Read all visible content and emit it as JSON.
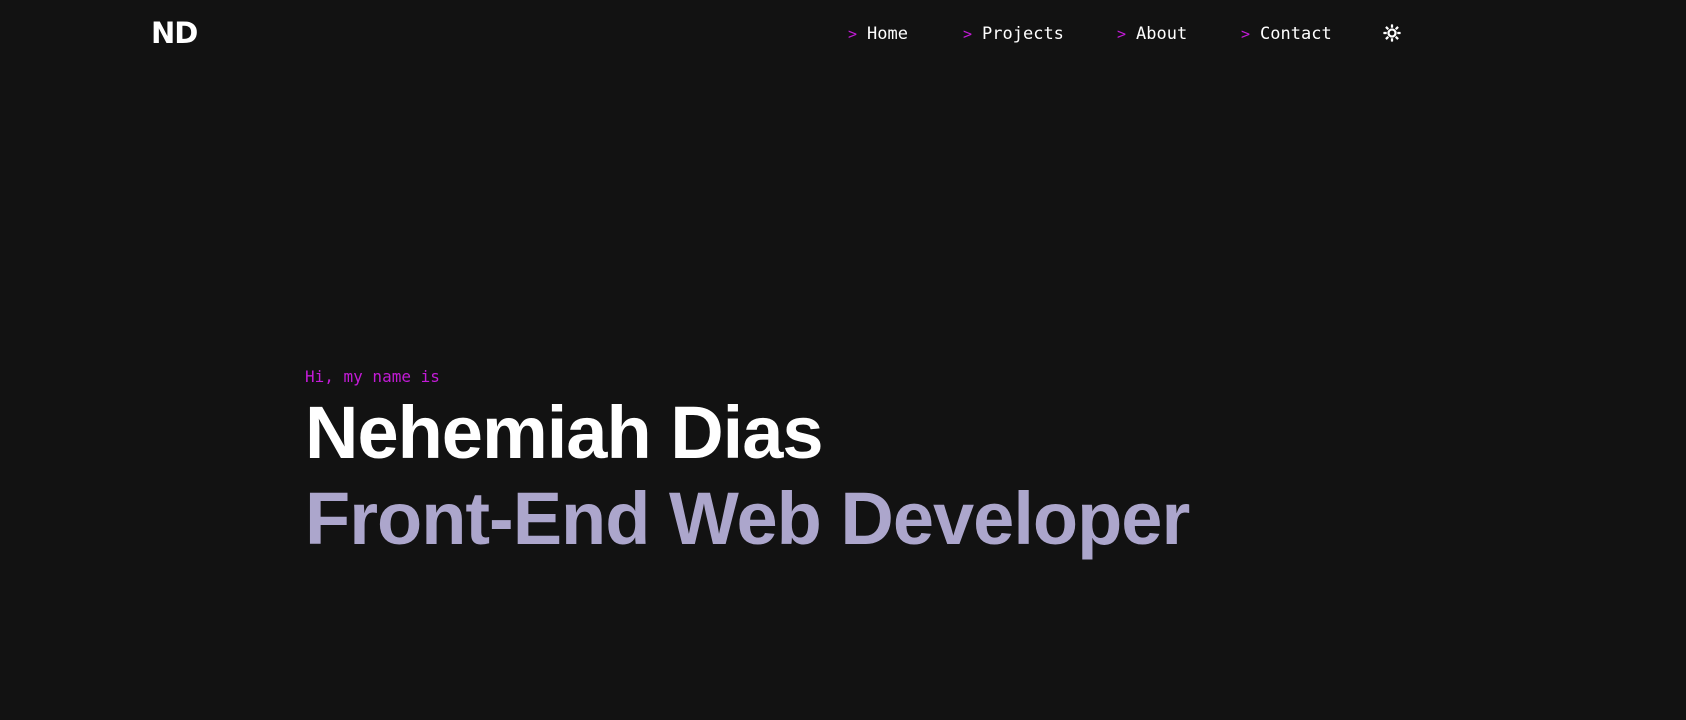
{
  "header": {
    "logo": "ND"
  },
  "nav": {
    "arrow": ">",
    "items": [
      {
        "label": "Home"
      },
      {
        "label": "Projects"
      },
      {
        "label": "About"
      },
      {
        "label": "Contact"
      }
    ],
    "theme_toggle_icon": "sun-icon"
  },
  "hero": {
    "intro": "Hi, my name is",
    "name": "Nehemiah Dias",
    "role": "Front-End Web Developer"
  },
  "colors": {
    "background": "#121212",
    "accent": "#c21bd6",
    "text": "#ffffff",
    "role_text": "#aca6cc"
  }
}
